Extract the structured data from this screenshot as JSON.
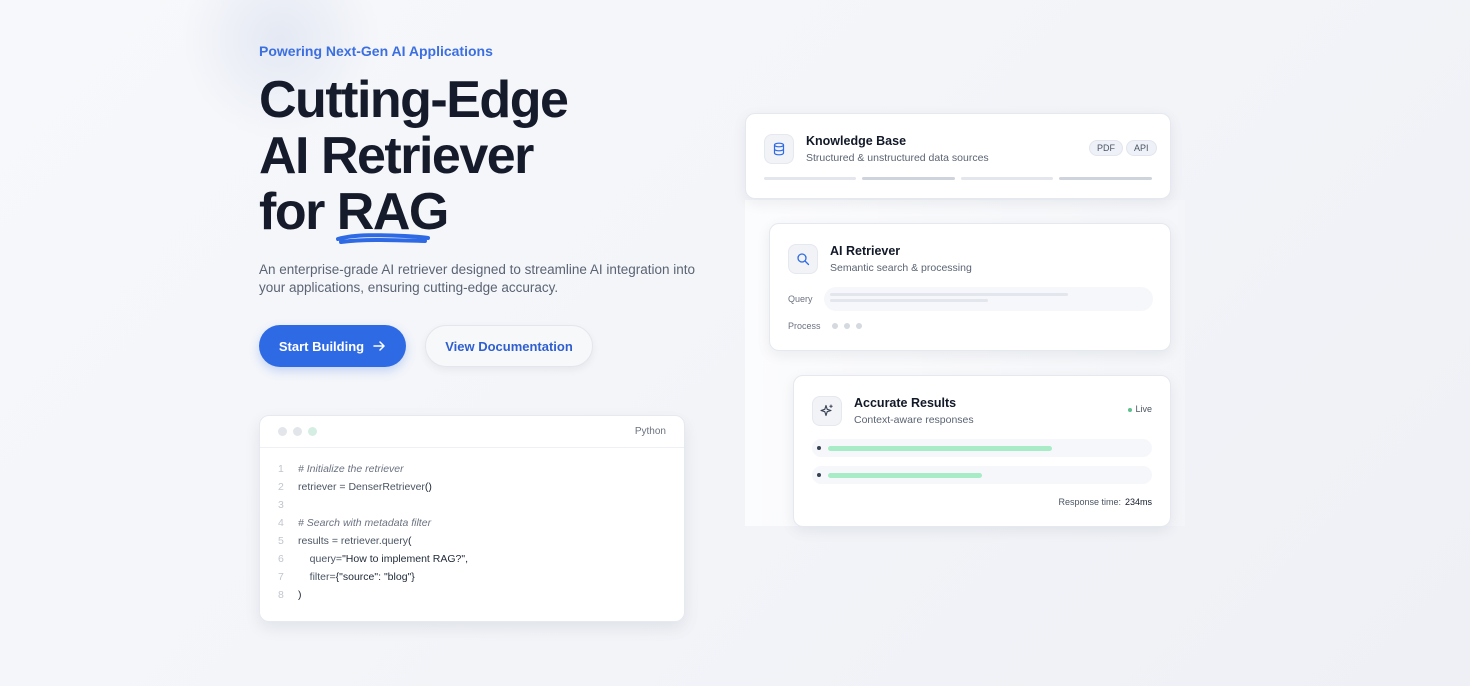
{
  "hero": {
    "eyebrow": "Powering Next-Gen AI Applications",
    "headline_line1": "Cutting-Edge",
    "headline_line2": "AI Retriever",
    "headline_line3_prefix": "for ",
    "headline_line3_highlight": "RAG",
    "subtext": "An enterprise-grade AI retriever designed to streamline AI integration into your applications, ensuring cutting-edge accuracy.",
    "primary_button": "Start Building",
    "secondary_button": "View Documentation"
  },
  "code_card": {
    "language": "Python",
    "lines": [
      {
        "num": "1",
        "parts": [
          {
            "cls": "cm",
            "text": "# Initialize the retriever"
          }
        ]
      },
      {
        "num": "2",
        "parts": [
          {
            "cls": "tx",
            "text": "retriever = DenserRetriever"
          },
          {
            "cls": "st",
            "text": "()"
          }
        ]
      },
      {
        "num": "3",
        "parts": []
      },
      {
        "num": "4",
        "parts": [
          {
            "cls": "cm",
            "text": "# Search with metadata filter"
          }
        ]
      },
      {
        "num": "5",
        "parts": [
          {
            "cls": "tx",
            "text": "results = retriever.query"
          },
          {
            "cls": "st",
            "text": "("
          }
        ]
      },
      {
        "num": "6",
        "parts": [
          {
            "cls": "tx",
            "text": "    query="
          },
          {
            "cls": "st",
            "text": "\"How to implement RAG?\","
          }
        ]
      },
      {
        "num": "7",
        "parts": [
          {
            "cls": "tx",
            "text": "    filter="
          },
          {
            "cls": "st",
            "text": "{\"source\": \"blog\"}"
          }
        ]
      },
      {
        "num": "8",
        "parts": [
          {
            "cls": "st",
            "text": ")"
          }
        ]
      }
    ]
  },
  "knowledge_base": {
    "title": "Knowledge Base",
    "subtitle": "Structured & unstructured data sources",
    "tags": [
      "PDF",
      "API"
    ],
    "icon": "database-icon"
  },
  "ai_retriever": {
    "title": "AI Retriever",
    "subtitle": "Semantic search & processing",
    "query_label": "Query",
    "process_label": "Process",
    "icon": "search-icon"
  },
  "accurate_results": {
    "title": "Accurate Results",
    "subtitle": "Context-aware responses",
    "live_label": "Live",
    "response_label": "Response time:",
    "response_value": "234ms",
    "result_fill": [
      0.7,
      0.48
    ],
    "icon": "sparkle-icon"
  },
  "colors": {
    "accent": "#2f6ae5",
    "result_bar": "#a7ecc6"
  }
}
